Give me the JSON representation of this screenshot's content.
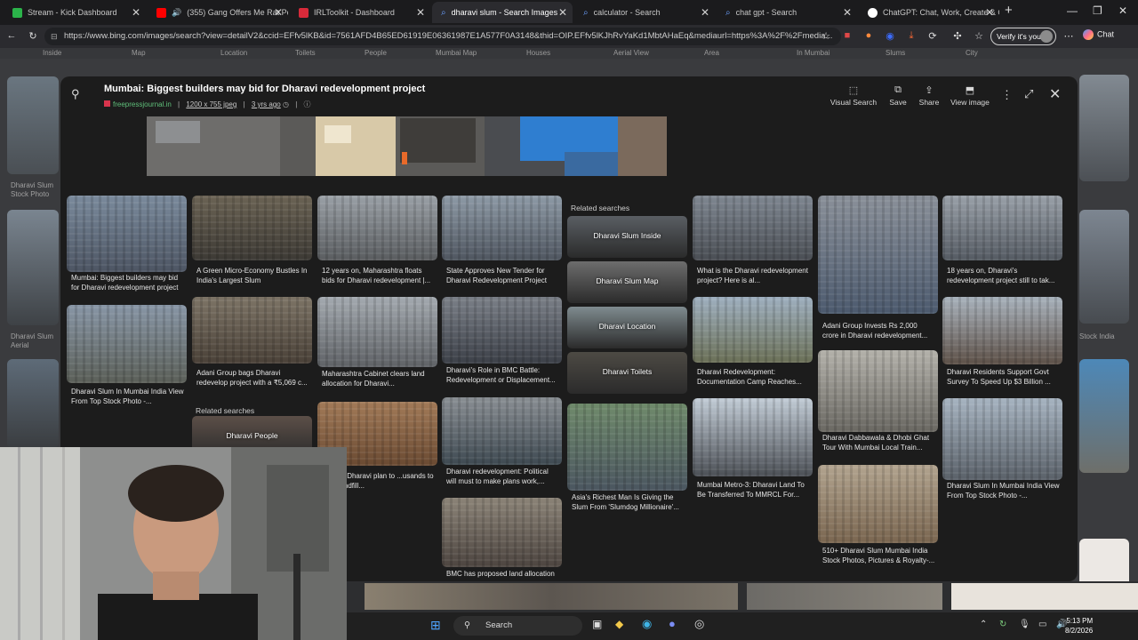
{
  "tabs": [
    {
      "title": "Stream - Kick Dashboard",
      "color": "#2bb34a"
    },
    {
      "title": "(355) Gang Offers Me Rat Poi",
      "color": "#ff0000"
    },
    {
      "title": "IRLToolkit - Dashboard",
      "color": "#d82a3a"
    },
    {
      "title": "dharavi slum - Search Images",
      "color": "#3c7dff"
    },
    {
      "title": "calculator - Search",
      "color": "#3c7dff"
    },
    {
      "title": "chat gpt - Search",
      "color": "#3c7dff"
    },
    {
      "title": "ChatGPT: Chat, Work, Create & Co",
      "color": "#ffffff"
    }
  ],
  "address": {
    "url": "https://www.bing.com/images/search?view=detailV2&ccid=EFfv5lKB&id=7561AFD4B65ED61919E06361987E1A577F0A3148&thid=OIP.EFfv5lKJhRvYaKd1MbtAHaEq&mediaurl=https%3A%2F%2Fmedia...",
    "verify_label": "Verify it's you",
    "chat_label": "Chat"
  },
  "bg_chips": [
    "Inside",
    "Map",
    "Location",
    "Toilets",
    "People",
    "Mumbai Map",
    "Houses",
    "Aerial View",
    "Area",
    "In Mumbai",
    "Slums",
    "City"
  ],
  "bg_captions": [
    "Dharavi Slum Stock Photo",
    "Dharavi Slum Aerial",
    "Stock India"
  ],
  "modal": {
    "title": "Mumbai: Biggest builders may bid for Dharavi redevelopment project",
    "source": "freepressjournal.in",
    "size": "1200 x 755 jpeg",
    "age": "3 yrs ago",
    "actions": [
      {
        "label": "Visual Search",
        "icon": "visual-search-icon"
      },
      {
        "label": "Save",
        "icon": "save-icon"
      },
      {
        "label": "Share",
        "icon": "share-icon"
      },
      {
        "label": "View image",
        "icon": "view-image-icon"
      }
    ]
  },
  "tiles": [
    {
      "caption": "Mumbai: Biggest builders may bid for Dharavi redevelopment project",
      "c1": "#7a8a9c",
      "c2": "#4d5563"
    },
    {
      "caption": "A Green Micro-Economy Bustles In India's Largest Slum",
      "c1": "#6b6354",
      "c2": "#3d3a35"
    },
    {
      "caption": "12 years on, Maharashtra floats bids for Dharavi redevelopment |...",
      "c1": "#9aa0a6",
      "c2": "#5a5d60"
    },
    {
      "caption": "State Approves New Tender for Dharavi Redevelopment Project",
      "c1": "#8e9aa6",
      "c2": "#4f5660"
    },
    {
      "caption": "What is the Dharavi redevelopment project? Here is al...",
      "c1": "#7f8791",
      "c2": "#4a4e54"
    },
    {
      "caption": "Adani Group Invests Rs 2,000 crore in Dharavi redevelopment...",
      "c1": "#8a9099",
      "c2": "#4c5a6e"
    },
    {
      "caption": "18 years on, Dharavi's redevelopment project still to tak...",
      "c1": "#99a0a8",
      "c2": "#555b63"
    },
    {
      "caption": "Dharavi Slum In Mumbai India View From Top Stock Photo -...",
      "c1": "#8896a6",
      "c2": "#5b5f58"
    },
    {
      "caption": "Adani Group bags Dharavi redevelop project with a ₹5,069 c...",
      "c1": "#7d7466",
      "c2": "#4a4138"
    },
    {
      "caption": "Maharashtra Cabinet clears land allocation for Dharavi...",
      "c1": "#a4aab0",
      "c2": "#5f6266"
    },
    {
      "caption": "Dharavi's Role in BMC Battle: Redevelopment or Displacement...",
      "c1": "#7b8088",
      "c2": "#3c4048"
    },
    {
      "caption": "Dharavi Redevelopment: Documentation Camp Reaches...",
      "c1": "#9fb0c0",
      "c2": "#6b7057"
    },
    {
      "caption": "Dharavi Residents Support Govt Survey To Speed Up $3 Billion ...",
      "c1": "#a9b3bd",
      "c2": "#5e5148"
    },
    {
      "caption": "Dharavi Dabbawala & Dhobi Ghat Tour With Mumbai Local Train...",
      "c1": "#b4b2ab",
      "c2": "#6a6862"
    },
    {
      "caption": "...htra's Dharavi plan to ...usands to toxic landfill...",
      "c1": "#a27a58",
      "c2": "#6a4a32"
    },
    {
      "caption": "Dharavi redevelopment: Political will must to make plans work,...",
      "c1": "#8a8f94",
      "c2": "#3f4a52"
    },
    {
      "caption": "Asia's Richest Man Is Giving the Slum From 'Slumdog Millionaire'...",
      "c1": "#6f8a6b",
      "c2": "#4b5660"
    },
    {
      "caption": "Mumbai Metro-3: Dharavi Land To Be Transferred To MMRCL For...",
      "c1": "#c2ccd6",
      "c2": "#4c5056"
    },
    {
      "caption": "Dharavi Slum In Mumbai India View From Top Stock Photo -...",
      "c1": "#a7b4c1",
      "c2": "#5a6169"
    },
    {
      "caption": "510+ Dharavi Slum Mumbai India Stock Photos, Pictures & Royalty-...",
      "c1": "#b2a48f",
      "c2": "#7a6650"
    },
    {
      "caption": "BMC has proposed land allocation",
      "c1": "#8c8478",
      "c2": "#4d4540"
    }
  ],
  "related_head_1": "Related searches",
  "related_head_2": "Related searches",
  "related": [
    {
      "label": "Dharavi Slum Inside",
      "c1": "#5a5e63"
    },
    {
      "label": "Dharavi Slum Map",
      "c1": "#6d6d6d"
    },
    {
      "label": "Dharavi Location",
      "c1": "#7f8b8f"
    },
    {
      "label": "Dharavi Toilets",
      "c1": "#4d4a44"
    },
    {
      "label": "Dharavi People",
      "c1": "#5c4f48"
    }
  ],
  "taskbar": {
    "search_label": "Search",
    "time": "5:13 PM",
    "date": "8/2/2026"
  }
}
